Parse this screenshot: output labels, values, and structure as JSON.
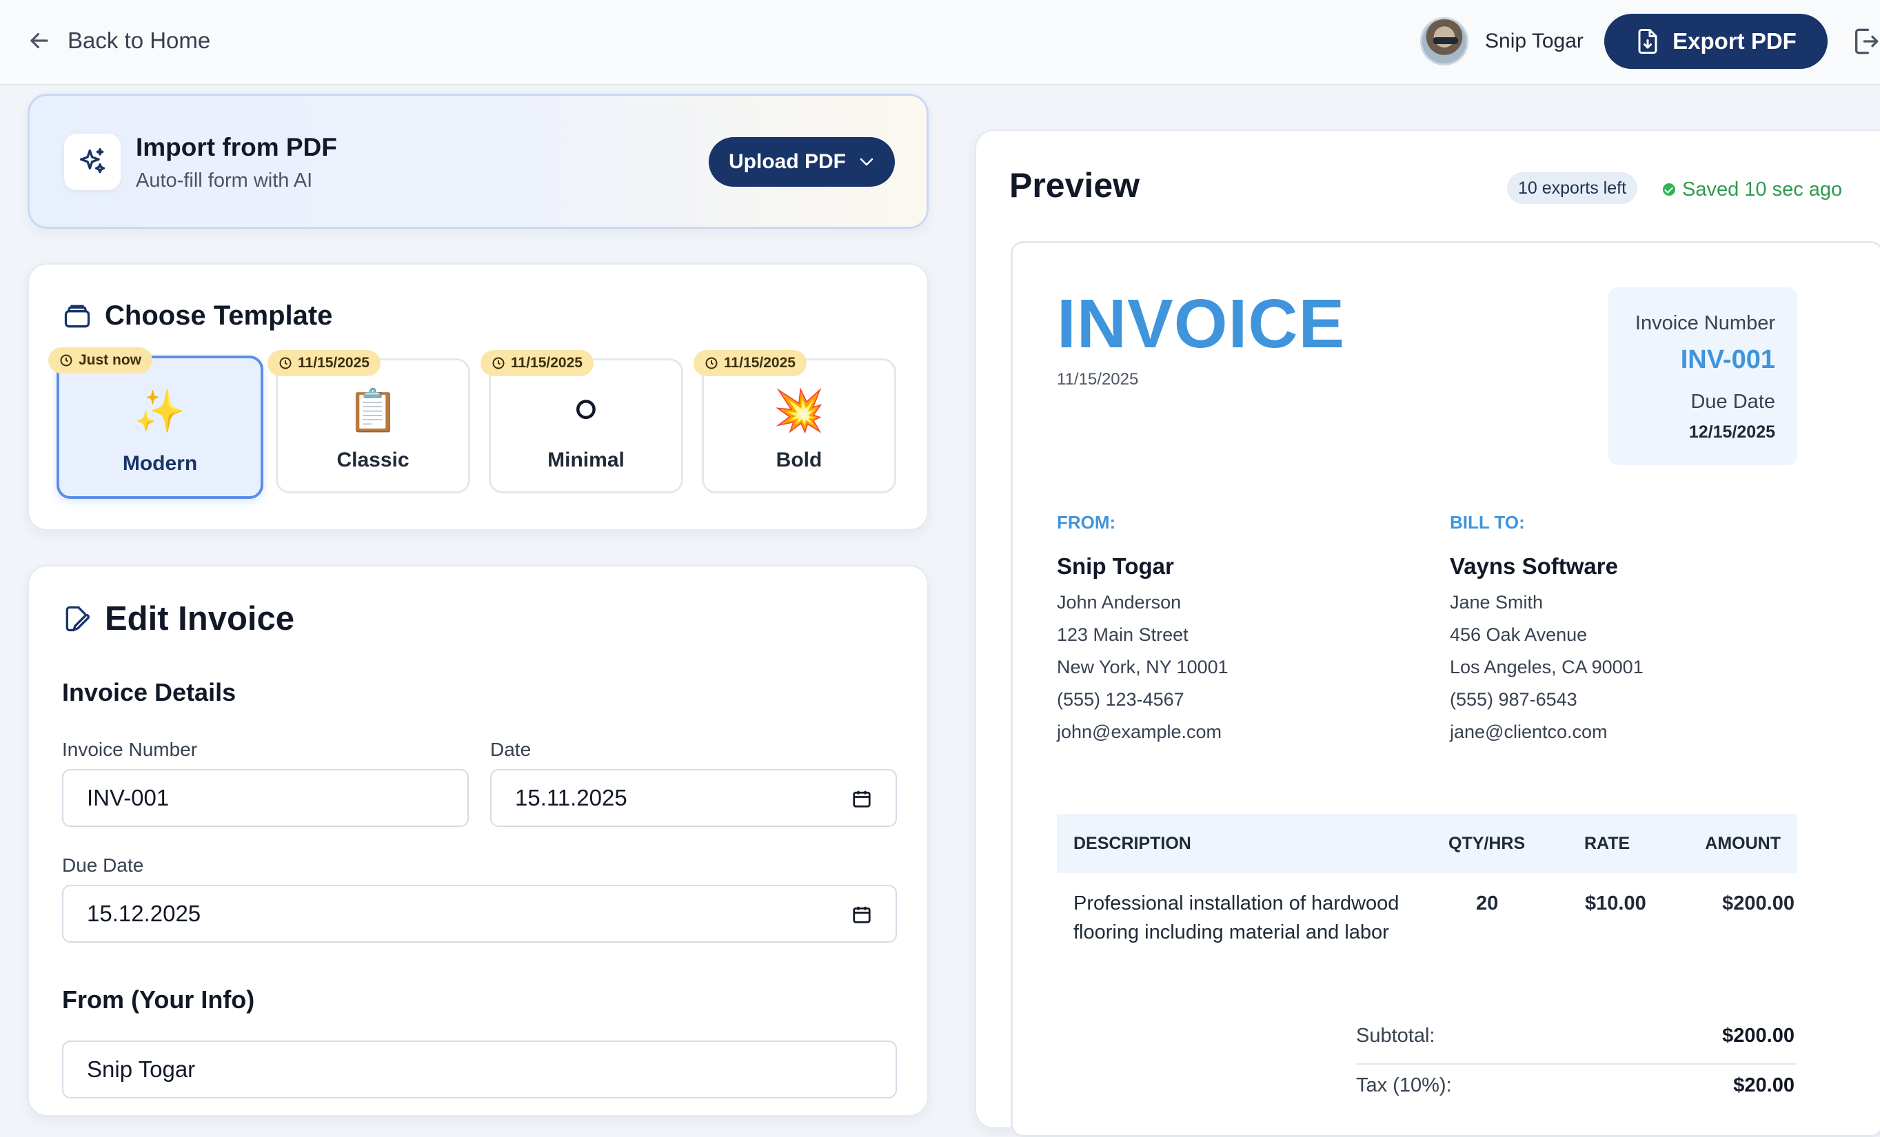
{
  "topbar": {
    "back_label": "Back to Home",
    "user_name": "Snip Togar",
    "export_label": "Export PDF"
  },
  "import": {
    "title": "Import from PDF",
    "subtitle": "Auto-fill form with AI",
    "button_label": "Upload PDF"
  },
  "templates": {
    "heading": "Choose Template",
    "items": [
      {
        "label": "Modern",
        "badge": "Just now",
        "emoji": "✨"
      },
      {
        "label": "Classic",
        "badge": "11/15/2025",
        "emoji": "📋"
      },
      {
        "label": "Minimal",
        "badge": "11/15/2025",
        "emoji": "⚪"
      },
      {
        "label": "Bold",
        "badge": "11/15/2025",
        "emoji": "💥"
      }
    ],
    "selected": "Modern"
  },
  "edit": {
    "heading": "Edit Invoice",
    "details_heading": "Invoice Details",
    "invoice_number_label": "Invoice Number",
    "invoice_number_value": "INV-001",
    "date_label": "Date",
    "date_value": "15.11.2025",
    "due_date_label": "Due Date",
    "due_date_value": "15.12.2025",
    "from_heading": "From (Your Info)",
    "from_name_value": "Snip Togar"
  },
  "preview": {
    "title": "Preview",
    "exports_left": "10 exports left",
    "saved_status": "Saved 10 sec ago",
    "invoice": {
      "title": "INVOICE",
      "date": "11/15/2025",
      "number_label": "Invoice Number",
      "number": "INV-001",
      "due_label": "Due Date",
      "due_date": "12/15/2025",
      "from": {
        "label": "FROM:",
        "company": "Snip Togar",
        "lines": [
          "John Anderson",
          "123 Main Street",
          "New York, NY 10001",
          "(555) 123-4567",
          "john@example.com"
        ]
      },
      "bill_to": {
        "label": "BILL TO:",
        "company": "Vayns Software",
        "lines": [
          "Jane Smith",
          "456 Oak Avenue",
          "Los Angeles, CA 90001",
          "(555) 987-6543",
          "jane@clientco.com"
        ]
      },
      "table": {
        "headers": [
          "DESCRIPTION",
          "QTY/HRS",
          "RATE",
          "AMOUNT"
        ],
        "rows": [
          {
            "description_1": "Professional installation of hardwood",
            "description_2": "flooring including material and labor",
            "qty": "20",
            "rate": "$10.00",
            "amount": "$200.00"
          }
        ]
      },
      "totals": {
        "subtotal_label": "Subtotal:",
        "subtotal": "$200.00",
        "tax_label": "Tax (10%):",
        "tax": "$20.00"
      }
    }
  },
  "colors": {
    "primary_navy": "#183468",
    "accent_blue": "#3f94dc",
    "badge_yellow": "#fbe5a7",
    "saved_green": "#2f9a4e"
  }
}
